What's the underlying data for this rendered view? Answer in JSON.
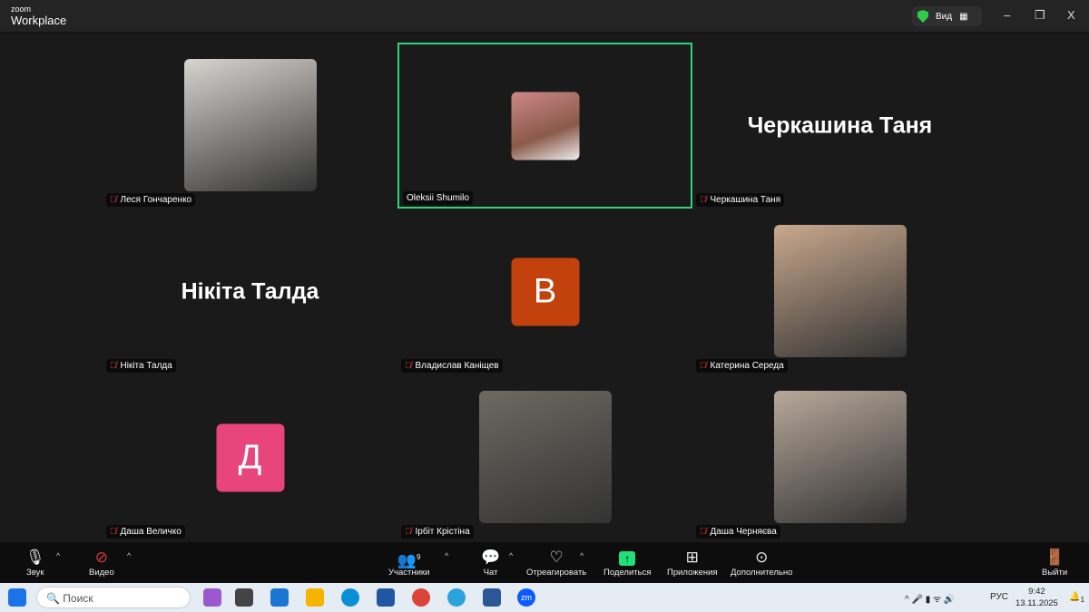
{
  "titlebar": {
    "logo_small": "zoom",
    "logo_big": "Workplace",
    "view_label": "Вид",
    "minimize": "–",
    "restore": "❐",
    "close": "X"
  },
  "participants": [
    {
      "name": "Леся Гончаренко",
      "type": "photo",
      "color": "#d8d4d0"
    },
    {
      "name": "Oleksii Shumilo",
      "type": "photo-small",
      "color": "#8a5a4a",
      "active": true
    },
    {
      "name": "Черкашина Таня",
      "type": "text",
      "big": "Черкашина Таня"
    },
    {
      "name": "Нікіта Талда",
      "type": "text",
      "big": "Нікіта Талда"
    },
    {
      "name": "Владислав Каніщев",
      "type": "avatar",
      "letter": "В",
      "color": "#c2410c"
    },
    {
      "name": "Катерина Середа",
      "type": "photo",
      "color": "#c9a88e"
    },
    {
      "name": "Даша Величко",
      "type": "avatar",
      "letter": "Д",
      "color": "#e8457c"
    },
    {
      "name": "Ірбіт Крістіна",
      "type": "photo",
      "color": "#6d6a62"
    },
    {
      "name": "Даша Черняєва",
      "type": "photo",
      "color": "#b8a89a"
    }
  ],
  "toolbar": {
    "audio": "Звук",
    "video": "Видео",
    "participants": "Участники",
    "participants_count": "9",
    "chat": "Чат",
    "react": "Отреагировать",
    "share": "Поделиться",
    "apps": "Приложения",
    "more": "Дополнительно",
    "leave": "Выйти"
  },
  "taskbar": {
    "search_placeholder": "Поиск",
    "lang": "РУС",
    "time": "9:42",
    "date": "13.11.2025",
    "notif": "1"
  }
}
